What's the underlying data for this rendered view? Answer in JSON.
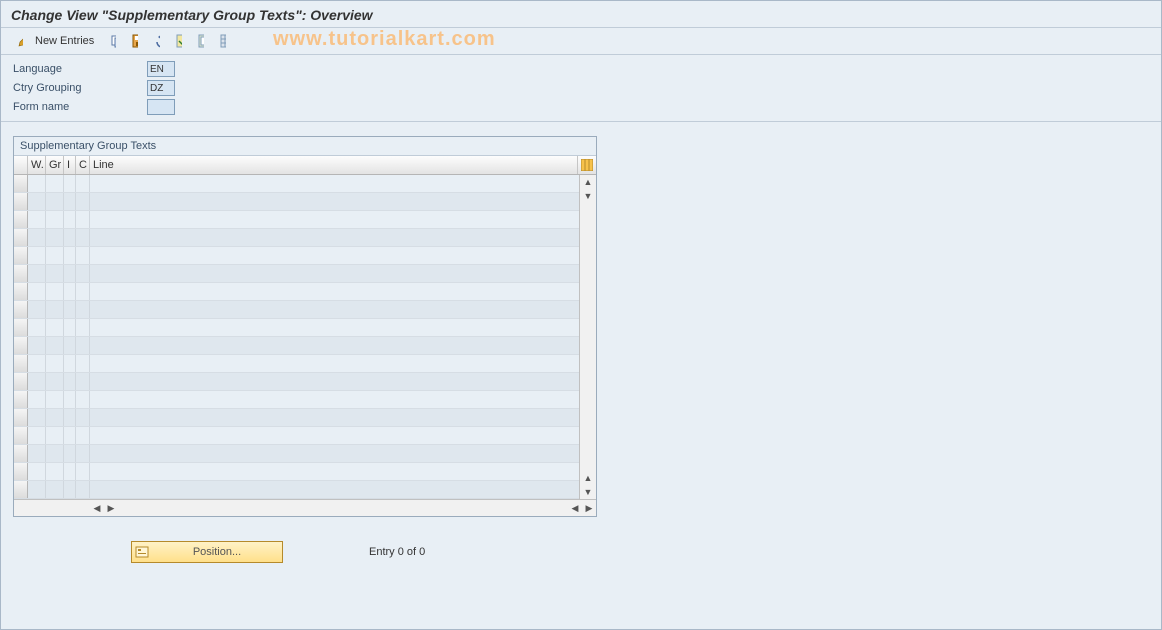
{
  "title": "Change View \"Supplementary Group Texts\": Overview",
  "watermark": "www.tutorialkart.com",
  "toolbar": {
    "new_entries": "New Entries"
  },
  "fields": {
    "language_label": "Language",
    "language_value": "EN",
    "ctry_label": "Ctry Grouping",
    "ctry_value": "DZ",
    "form_label": "Form name",
    "form_value": ""
  },
  "table": {
    "caption": "Supplementary Group Texts",
    "columns": {
      "w": "W.",
      "gr": "Gr",
      "i": "I",
      "c": "C",
      "line": "Line"
    },
    "row_count": 18
  },
  "footer": {
    "position_label": "Position...",
    "entry_label": "Entry 0 of 0"
  }
}
